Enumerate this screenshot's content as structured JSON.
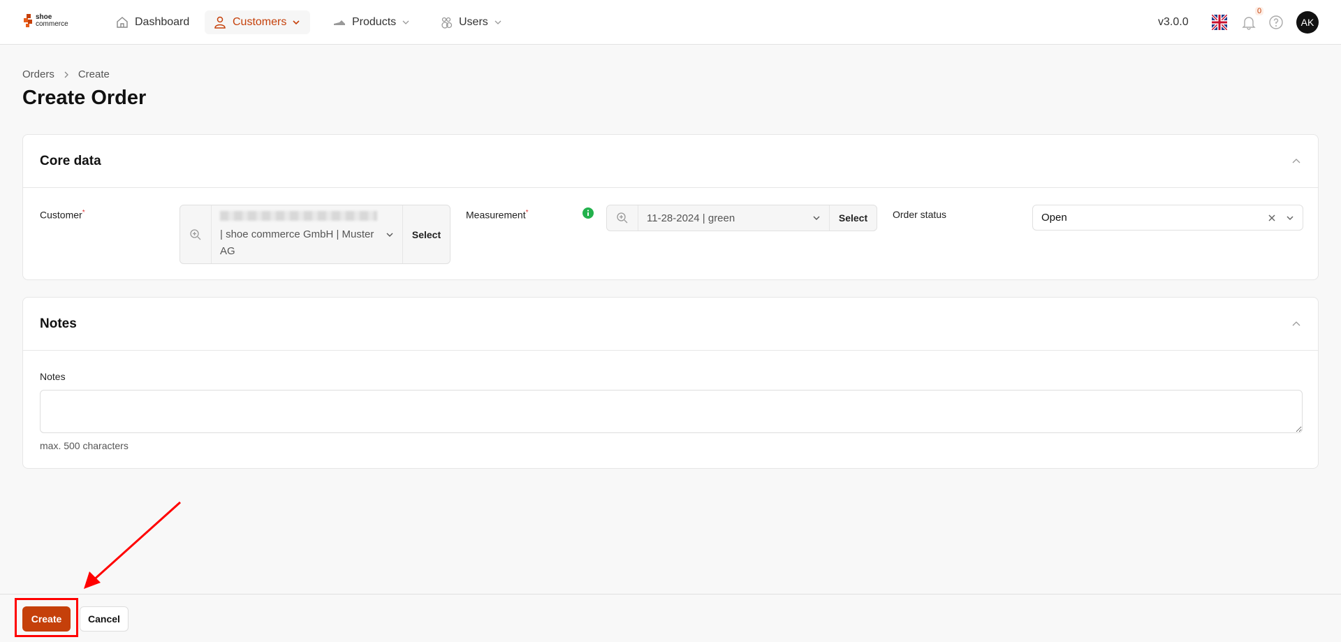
{
  "brand": {
    "line1": "shoe",
    "line2": "commerce",
    "accent": "#c5400a"
  },
  "nav": [
    {
      "label": "Dashboard",
      "icon": "home-icon"
    },
    {
      "label": "Customers",
      "icon": "user-icon",
      "active": true
    },
    {
      "label": "Products",
      "icon": "shoe-icon"
    },
    {
      "label": "Users",
      "icon": "users-icon"
    }
  ],
  "header": {
    "version": "v3.0.0",
    "notifications": "0",
    "avatar": "AK"
  },
  "breadcrumb": [
    "Orders",
    "Create"
  ],
  "title": "Create Order",
  "core": {
    "title": "Core data",
    "customer_label": "Customer",
    "customer_value_l2": "| shoe commerce GmbH | Muster",
    "customer_value_l3": "AG",
    "select": "Select",
    "measurement_label": "Measurement",
    "measurement_value": "11-28-2024 | green",
    "status_label": "Order status",
    "status_value": "Open"
  },
  "notes": {
    "title": "Notes",
    "label": "Notes",
    "value": "",
    "help": "max. 500 characters"
  },
  "footer": {
    "create": "Create",
    "cancel": "Cancel"
  }
}
